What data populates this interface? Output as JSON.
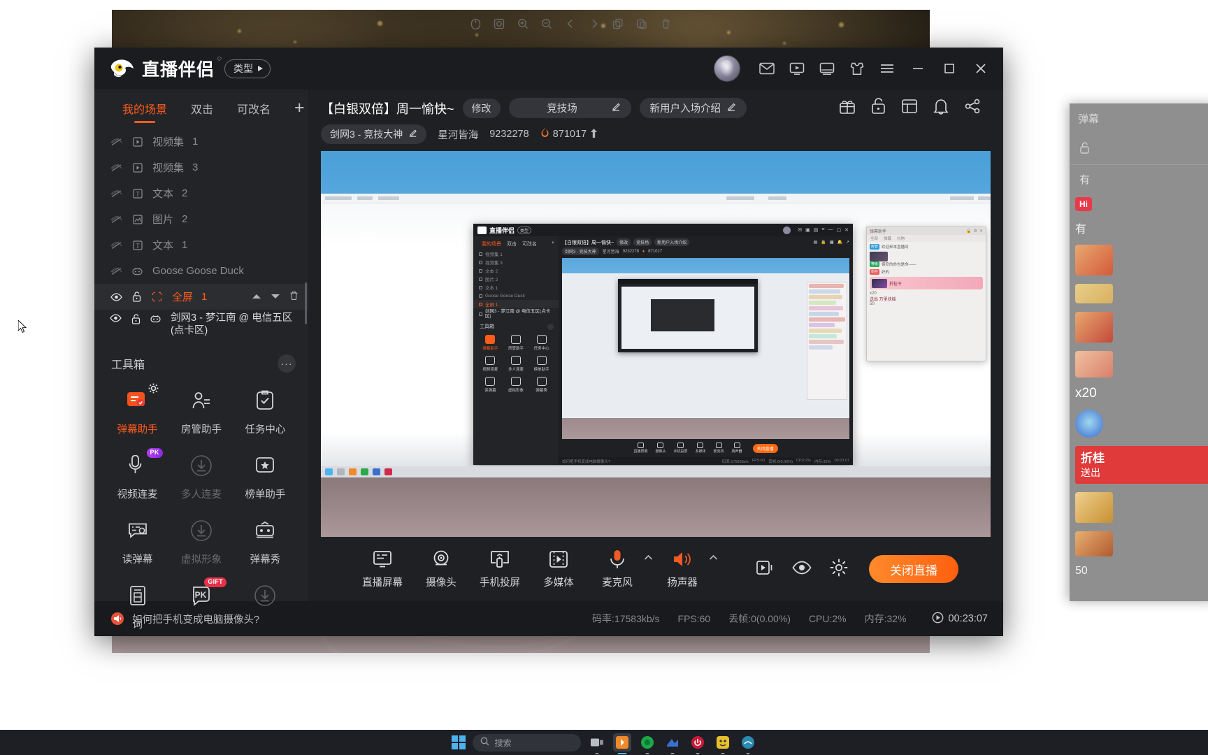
{
  "app": {
    "brand": "直播伴侣",
    "brand_sup": "◌",
    "type_button": "类型",
    "titlebar_icons": [
      "mail-icon",
      "screen-record-icon",
      "monitor-icon",
      "shirt-icon",
      "menu-icon"
    ],
    "window_controls": {
      "minimize": "—",
      "maximize": "▢",
      "close": "✕"
    }
  },
  "float_toolbar": {
    "items": [
      "mouse-icon",
      "screenshot-icon",
      "zoom-in-icon",
      "zoom-out-icon",
      "back-icon",
      "forward-icon",
      "copy-icon",
      "paste-icon",
      "delete-icon"
    ]
  },
  "sidebar": {
    "tabs": [
      {
        "label": "我的场景",
        "active": true
      },
      {
        "label": "双击",
        "active": false
      },
      {
        "label": "可改名",
        "active": false
      }
    ],
    "add_label": "+",
    "scenes": [
      {
        "label": "视频集",
        "num": " 1",
        "icon": "video-icon",
        "selected": false,
        "hidden": true
      },
      {
        "label": "视频集",
        "num": " 3",
        "icon": "video-icon",
        "selected": false,
        "hidden": true
      },
      {
        "label": "文本",
        "num": " 2",
        "icon": "text-icon",
        "selected": false,
        "hidden": true
      },
      {
        "label": "图片",
        "num": " 2",
        "icon": "image-icon",
        "selected": false,
        "hidden": true
      },
      {
        "label": "文本",
        "num": " 1",
        "icon": "text-icon",
        "selected": false,
        "hidden": true
      },
      {
        "label": "Goose Goose Duck",
        "num": "",
        "icon": "game-icon",
        "selected": false,
        "hidden": true
      },
      {
        "label": "全屏",
        "num": " 1",
        "icon": "fullscreen-icon",
        "selected": true,
        "hidden": false
      }
    ],
    "active_source": "剑网3 - 梦江南 @ 电信五区(点卡区)",
    "toolbox_title": "工具箱",
    "toolbox_more": "···",
    "tools": [
      {
        "label": "弹幕助手",
        "icon": "danmaku-assistant-icon",
        "accent": true,
        "dim": false,
        "badge": "",
        "gear": true
      },
      {
        "label": "房管助手",
        "icon": "room-admin-icon",
        "accent": false,
        "dim": false,
        "badge": "",
        "gear": false
      },
      {
        "label": "任务中心",
        "icon": "task-center-icon",
        "accent": false,
        "dim": false,
        "badge": "",
        "gear": false
      },
      {
        "label": "视频连麦",
        "icon": "video-mic-icon",
        "accent": false,
        "dim": false,
        "badge": "PK",
        "gear": false
      },
      {
        "label": "多人连麦",
        "icon": "download-icon",
        "accent": false,
        "dim": true,
        "badge": "",
        "gear": false
      },
      {
        "label": "榜单助手",
        "icon": "rank-assistant-icon",
        "accent": false,
        "dim": false,
        "badge": "",
        "gear": false
      },
      {
        "label": "读弹幕",
        "icon": "read-danmaku-icon",
        "accent": false,
        "dim": false,
        "badge": "",
        "gear": false
      },
      {
        "label": "虚拟形象",
        "icon": "download-icon",
        "accent": false,
        "dim": true,
        "badge": "",
        "gear": false
      },
      {
        "label": "弹幕秀",
        "icon": "danmaku-show-icon",
        "accent": false,
        "dim": false,
        "badge": "",
        "gear": false
      },
      {
        "label": "词",
        "icon": "lyrics-icon",
        "accent": false,
        "dim": false,
        "badge": "",
        "gear": false
      },
      {
        "label": "PK",
        "icon": "pk-icon",
        "accent": false,
        "dim": false,
        "badge": "GIFT",
        "gear": false
      },
      {
        "label": "",
        "icon": "download-icon",
        "accent": false,
        "dim": true,
        "badge": "",
        "gear": false
      }
    ]
  },
  "stream": {
    "title": "【白银双倍】周一愉快~",
    "modify_button": "修改",
    "category": "竞技场",
    "intro_button": "新用户入场介绍",
    "sub_category": "剑网3 - 竞技大神",
    "nickname": "星河皆海",
    "room_id": "9232278",
    "popularity": "871017",
    "head_icons": [
      "gift-icon",
      "lock-icon",
      "layout-icon",
      "bell-icon",
      "share-icon"
    ]
  },
  "preview": {
    "inner_brand": "直播伴侣",
    "inner_type": "类型",
    "inner_tabs": [
      "我的场景",
      "双击",
      "可改名"
    ],
    "inner_scenes": [
      "视频集 1",
      "视频集 3",
      "文本 2",
      "图片 2",
      "文本 1",
      "Goose Goose Duck",
      "全屏 1",
      "剑网3 - 梦江南 @ 电信五区(点卡区)"
    ],
    "inner_toolbox": "工具箱",
    "inner_tools": [
      "弹幕助手",
      "房管助手",
      "任务中心",
      "视频连麦",
      "多人连麦",
      "榜单助手",
      "读弹幕",
      "虚拟形象",
      "弹幕秀"
    ],
    "inner_title": "【白银双倍】周一愉快~",
    "inner_modify": "修改",
    "inner_category": "竞技场",
    "inner_intro": "新用户入场介绍",
    "inner_subcat": "剑网3 - 竞技大神",
    "inner_nick": "星河皆海",
    "inner_roomid": "9232278",
    "inner_pop": "871017",
    "inner_controls": [
      "直播屏幕",
      "摄像头",
      "手机投屏",
      "多媒体",
      "麦克风",
      "扬声器"
    ],
    "inner_live_btn": "关闭直播",
    "inner_tip": "如何把手机变成电脑摄像头?",
    "inner_status": [
      "码率:17583kb/s",
      "FPS:60",
      "丢帧:0(0.00%)",
      "CPU:2%",
      "内存:32%",
      "00:23:07"
    ],
    "chat_title": "弹幕助手",
    "chat_tabs": [
      "全部",
      "弹幕",
      "礼物"
    ],
    "chat_messages": [
      {
        "tag": "房管",
        "tag_color": "#2d9cdb",
        "text": "欢迎来本直播间"
      },
      {
        "tag": "等级",
        "tag_color": "#27ae60",
        "text": "保安的命也是命——"
      },
      {
        "tag": "粉丝",
        "tag_color": "#eb5757",
        "text": "好的"
      }
    ],
    "chat_gift_count": "x20",
    "chat_gift_text": "折桂令",
    "chat_send": "送出 万里扶摇",
    "chat_num": "50"
  },
  "controls": {
    "items": [
      {
        "label": "直播屏幕",
        "icon": "live-screen-icon",
        "has_caret": false
      },
      {
        "label": "摄像头",
        "icon": "camera-icon",
        "has_caret": false
      },
      {
        "label": "手机投屏",
        "icon": "phone-cast-icon",
        "has_caret": false
      },
      {
        "label": "多媒体",
        "icon": "media-icon",
        "has_caret": false
      },
      {
        "label": "麦克风",
        "icon": "microphone-icon",
        "has_caret": true
      },
      {
        "label": "扬声器",
        "icon": "speaker-icon",
        "has_caret": true
      }
    ],
    "right_icons": [
      "record-icon",
      "preview-eye-icon",
      "settings-gear-icon"
    ],
    "live_button": "关闭直播"
  },
  "statusbar": {
    "tip": "如何把手机变成电脑摄像头?",
    "stats": [
      {
        "label": "码率:17583kb/s"
      },
      {
        "label": "FPS:60"
      },
      {
        "label": "丢帧:0(0.00%)"
      },
      {
        "label": "CPU:2%"
      },
      {
        "label": "内存:32%"
      }
    ],
    "timer": "00:23:07"
  },
  "danmaku_panel": {
    "title": "弹幕",
    "tab": "有",
    "hi_badge": "Hi",
    "gift_count": "x20",
    "banner_line1": "折桂",
    "banner_line2": "送出",
    "number": "50"
  },
  "taskbar": {
    "search_placeholder": "搜索",
    "apps": [
      "task-view-icon",
      "app-orange-icon",
      "app-green-icon",
      "app-blue-icon",
      "app-red-icon",
      "app-yellow-icon",
      "app-teal-icon"
    ]
  },
  "colors": {
    "accent": "#ff5c1c",
    "live_button": "#ff6a13",
    "window_bg": "#1f2023",
    "sidebar_bg": "#232427",
    "titlebar_bg": "#1b1c1f"
  }
}
